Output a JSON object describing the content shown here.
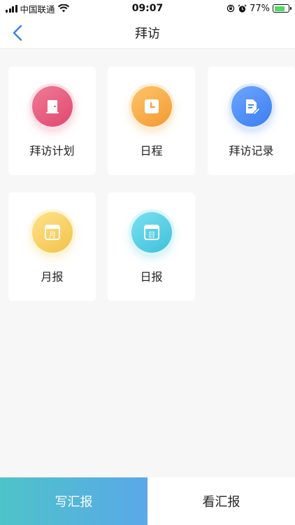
{
  "status_bar": {
    "carrier": "中国联通",
    "time": "09:07",
    "battery": "77%",
    "battery_level": 0.77
  },
  "nav": {
    "title": "拜访",
    "back_icon": "chevron-left-icon"
  },
  "tiles": [
    {
      "label": "拜访计划",
      "icon": "door-icon",
      "color": "#e8507a"
    },
    {
      "label": "日程",
      "icon": "clock-icon",
      "color": "#f29a32"
    },
    {
      "label": "拜访记录",
      "icon": "document-edit-icon",
      "color": "#3a7ef0"
    },
    {
      "label": "月报",
      "icon": "calendar-month-icon",
      "color": "#f2c24a",
      "glyph": "月"
    },
    {
      "label": "日报",
      "icon": "calendar-day-icon",
      "color": "#3fc0dc",
      "glyph": "日"
    }
  ],
  "bottom": {
    "write_label": "写汇报",
    "view_label": "看汇报"
  }
}
